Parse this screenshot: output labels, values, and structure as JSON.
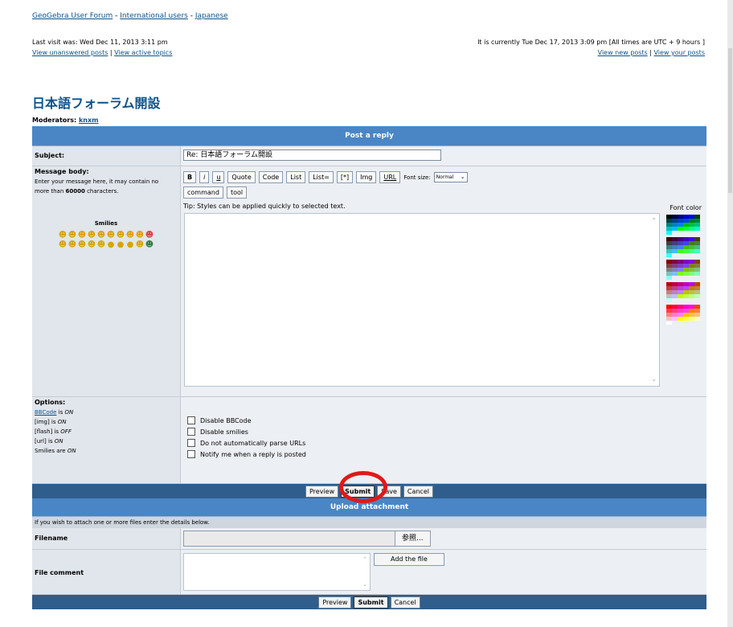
{
  "breadcrumb": [
    "GeoGebra User Forum",
    "International users",
    "Japanese"
  ],
  "last_visit": "Last visit was: Wed Dec 11, 2013 3:11 pm",
  "view_unanswered": "View unanswered posts",
  "view_active": "View active topics",
  "current_time": "It is currently Tue Dec 17, 2013 3:09 pm [All times are UTC + 9 hours ]",
  "view_new": "View new posts",
  "view_yours": "View your posts",
  "topic_title": "日本語フォーラム開設",
  "moderators_label": "Moderators:",
  "moderator": "knxm",
  "post_header": "Post a reply",
  "subject_label": "Subject:",
  "subject_value": "Re: 日本語フォーラム開設",
  "message_label": "Message body:",
  "message_hint_1": "Enter your message here, it may contain no",
  "message_hint_2a": "more than ",
  "message_hint_max": "60000",
  "message_hint_2b": " characters.",
  "smilies_title": "Smilies",
  "bbcode_buttons": [
    "B",
    "i",
    "u",
    "Quote",
    "Code",
    "List",
    "List=",
    "[*]",
    "Img",
    "URL"
  ],
  "font_size_label": "Font size:",
  "font_size_value": "Normal",
  "extra_buttons": [
    "command",
    "tool"
  ],
  "tip": "Tip: Styles can be applied quickly to selected text.",
  "font_color_label": "Font color",
  "options_label": "Options:",
  "bbcode_link": "BBCode",
  "bbcode_status_suffix": " is ",
  "bbcode_status": "ON",
  "img_status_label": "[img] is ",
  "img_status": "ON",
  "flash_status_label": "[flash] is ",
  "flash_status": "OFF",
  "url_status_label": "[url] is ",
  "url_status": "ON",
  "smilies_status_label": "Smilies are ",
  "smilies_status": "ON",
  "checkboxes": [
    "Disable BBCode",
    "Disable smilies",
    "Do not automatically parse URLs",
    "Notify me when a reply is posted"
  ],
  "actions": {
    "preview": "Preview",
    "submit": "Submit",
    "save": "Save",
    "cancel": "Cancel"
  },
  "upload_header": "Upload attachment",
  "upload_info": "If you wish to attach one or more files enter the details below.",
  "filename_label": "Filename",
  "browse_label": "参照...",
  "file_comment_label": "File comment",
  "add_file_label": "Add the file",
  "colors": {
    "header_blue": "#4a86c5",
    "action_bar": "#2f5d8c",
    "link": "#105289",
    "highlight_ring": "#e01919"
  }
}
